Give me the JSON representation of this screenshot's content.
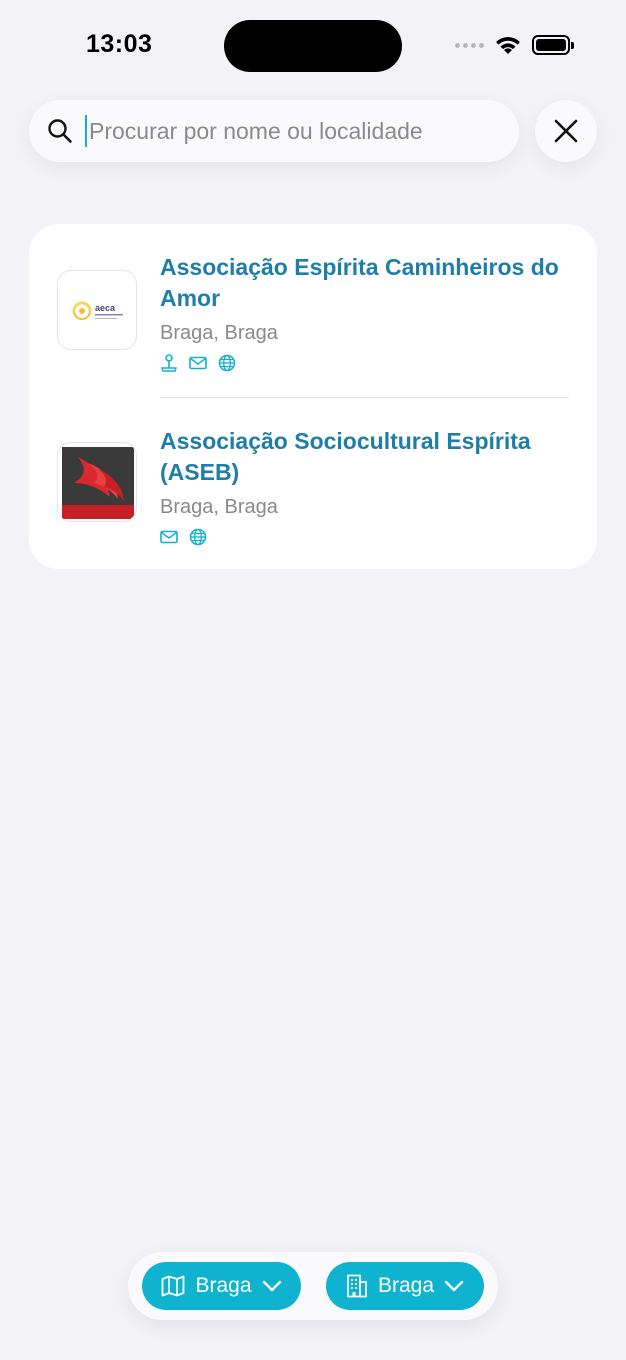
{
  "status": {
    "time": "13:03"
  },
  "search": {
    "placeholder": "Procurar por nome ou localidade",
    "value": ""
  },
  "results": [
    {
      "title": "Associação Espírita Caminheiros do Amor",
      "location": "Braga, Braga",
      "icons": [
        "map-pin-icon",
        "mail-icon",
        "globe-icon"
      ],
      "logo_text": "aeca"
    },
    {
      "title": "Associação Sociocultural Espírita (ASEB)",
      "location": "Braga, Braga",
      "icons": [
        "mail-icon",
        "globe-icon"
      ]
    }
  ],
  "filters": {
    "district": {
      "label": "Braga",
      "icon": "map-icon"
    },
    "municipality": {
      "label": "Braga",
      "icon": "building-icon"
    }
  },
  "colors": {
    "accent": "#10b3cf",
    "title": "#1f7ea8",
    "background": "#f2f2f7"
  }
}
